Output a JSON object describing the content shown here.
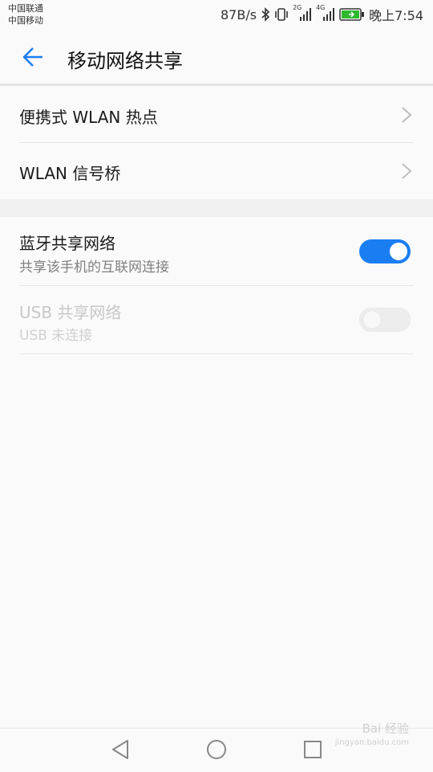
{
  "status_bar": {
    "carrier_1": "中国联通",
    "carrier_2": "中国移动",
    "net_speed": "87B/s",
    "sim1_network": "2G",
    "sim2_network": "4G",
    "time": "晚上7:54",
    "icons": [
      "bluetooth-icon",
      "vibrate-icon",
      "signal-icon",
      "battery-icon"
    ]
  },
  "header": {
    "title": "移动网络共享",
    "back_icon": "arrow-left-icon",
    "accent_color": "#1a7ef2"
  },
  "items": [
    {
      "title": "便携式 WLAN 热点",
      "type": "link"
    },
    {
      "title": "WLAN 信号桥",
      "type": "link"
    }
  ],
  "toggles": [
    {
      "title": "蓝牙共享网络",
      "subtitle": "共享该手机的互联网连接",
      "enabled": true,
      "state": "on"
    },
    {
      "title": "USB 共享网络",
      "subtitle": "USB 未连接",
      "enabled": false,
      "state": "off"
    }
  ],
  "nav_bar": {
    "buttons": [
      "back-triangle-icon",
      "home-circle-icon",
      "recents-square-icon"
    ]
  },
  "watermark": {
    "line1": "Bai 经验",
    "line2": "jingyan.baidu.com"
  }
}
